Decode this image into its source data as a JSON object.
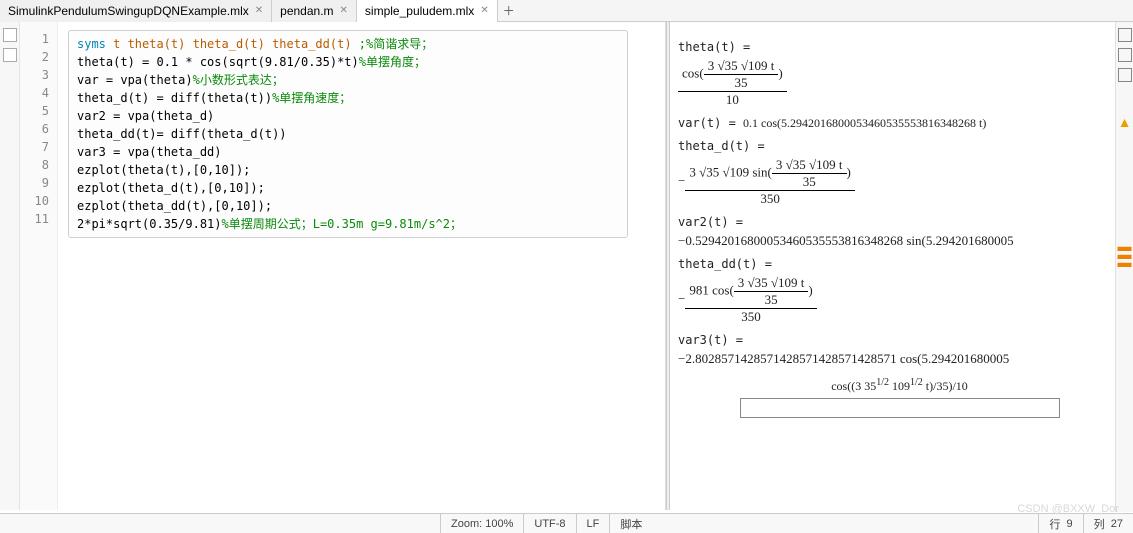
{
  "tabs": [
    {
      "label": "SimulinkPendulumSwingupDQNExample.mlx",
      "active": false
    },
    {
      "label": "pendan.m",
      "active": false
    },
    {
      "label": "simple_puludem.mlx",
      "active": true
    }
  ],
  "gutter": [
    "1",
    "2",
    "3",
    "4",
    "5",
    "6",
    "7",
    "8",
    "9",
    "10",
    "11"
  ],
  "code": {
    "l1_kw": "syms",
    "l1_ids": " t theta(t) theta_d(t) theta_dd(t) ",
    "l1_com": ";%简谐求导；",
    "l2": "theta(t) = 0.1 * cos(sqrt(9.81/0.35)*t)",
    "l2_com": "%单摆角度；",
    "l3": "var = vpa(theta)",
    "l3_com": "%小数形式表达；",
    "l4": "theta_d(t) = diff(theta(t))",
    "l4_com": "%单摆角速度；",
    "l5": "var2 = vpa(theta_d)",
    "l6": "theta_dd(t)= diff(theta_d(t))",
    "l7": "var3 = vpa(theta_dd)",
    "l8": "ezplot(theta(t),[0,10]);",
    "l9": "ezplot(theta_d(t),[0,10]);",
    "l10": "ezplot(theta_dd(t),[0,10]);",
    "l11": "2*pi*sqrt(0.35/9.81)",
    "l11_com": "%单摆周期公式；L=0.35m g=9.81m/s^2；"
  },
  "output": {
    "theta_label": "theta(t) =",
    "theta_num_inner": "3 √35  √109 t",
    "theta_num_den": "35",
    "theta_outer_den": "10",
    "theta_cos": "cos",
    "var_label": "var(t) = ",
    "var_val": " 0.1 cos(5.2942016800053460535553816348268 t)",
    "thetad_label": "theta_d(t) =",
    "td_pre": "3 √35  √109 sin",
    "td_inner_num": "3 √35  √109 t",
    "td_inner_den": "35",
    "td_outer_den": "350",
    "td_neg": "−",
    "var2_label": "var2(t) =",
    "var2_val": "−0.52942016800053460535553816348268 sin(5.294201680005",
    "thetadd_label": "theta_dd(t) =",
    "tdd_pre": "981 cos",
    "tdd_inner_num": "3 √35  √109 t",
    "tdd_inner_den": "35",
    "tdd_outer_den": "350",
    "tdd_neg": "−",
    "var3_label": "var3(t) =",
    "var3_val": "−2.8028571428571428571428571428571 cos(5.294201680005",
    "plot_title": "cos((3 35",
    "plot_title_sup1": "1/2",
    "plot_title_mid": " 109",
    "plot_title_sup2": "1/2",
    "plot_title_end": " t)/35)/10"
  },
  "status": {
    "zoom": "Zoom: 100%",
    "enc": "UTF-8",
    "lf": "LF",
    "script": "脚本",
    "row_lbl": "行",
    "row": "9",
    "col_lbl": "列",
    "col": "27"
  },
  "watermark": "CSDN @BXXW_Dor"
}
